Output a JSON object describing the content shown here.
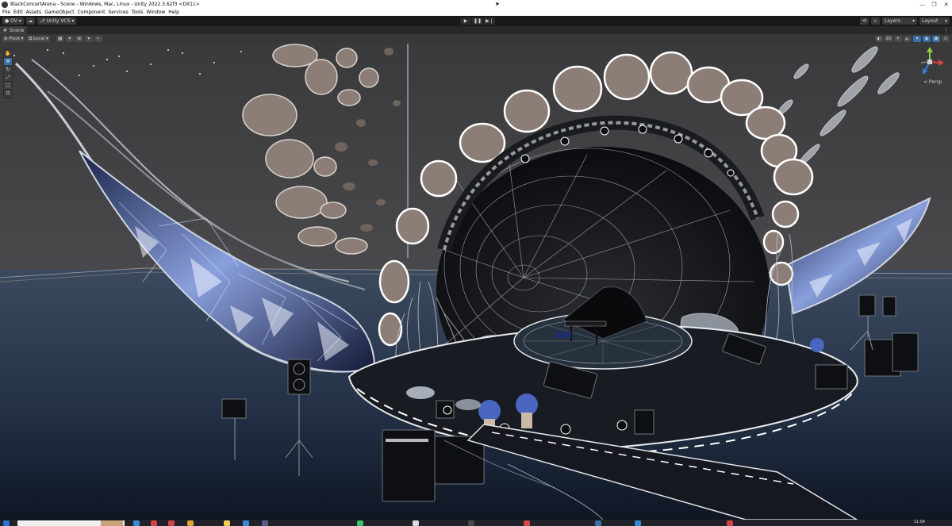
{
  "window": {
    "title": "BlackConcertArena - Scene - Windows, Mac, Linux - Unity 2022.3.62f3 <DX11>",
    "minimize": "—",
    "maximize": "❐",
    "close": "✕"
  },
  "menu": {
    "items": [
      "File",
      "Edit",
      "Assets",
      "GameObject",
      "Component",
      "Services",
      "Tools",
      "Window",
      "Help"
    ]
  },
  "toolbar": {
    "account": "OV",
    "vcs": "Unity VCS",
    "layers": "Layers",
    "layout": "Layout"
  },
  "scene_tab": {
    "label": "Scene"
  },
  "scene_toolbar": {
    "pivot": "Pivot",
    "local": "Local",
    "view_2d": "2D"
  },
  "gizmo": {
    "projection": "< Persp"
  },
  "taskbar": {
    "time": "11:04"
  },
  "colors": {
    "editor_bg": "#191919",
    "accent_blue": "#3a6fa8",
    "gizmo_x": "#d9433a",
    "gizmo_y": "#8fcf3a",
    "gizmo_z": "#3a7dd9"
  }
}
